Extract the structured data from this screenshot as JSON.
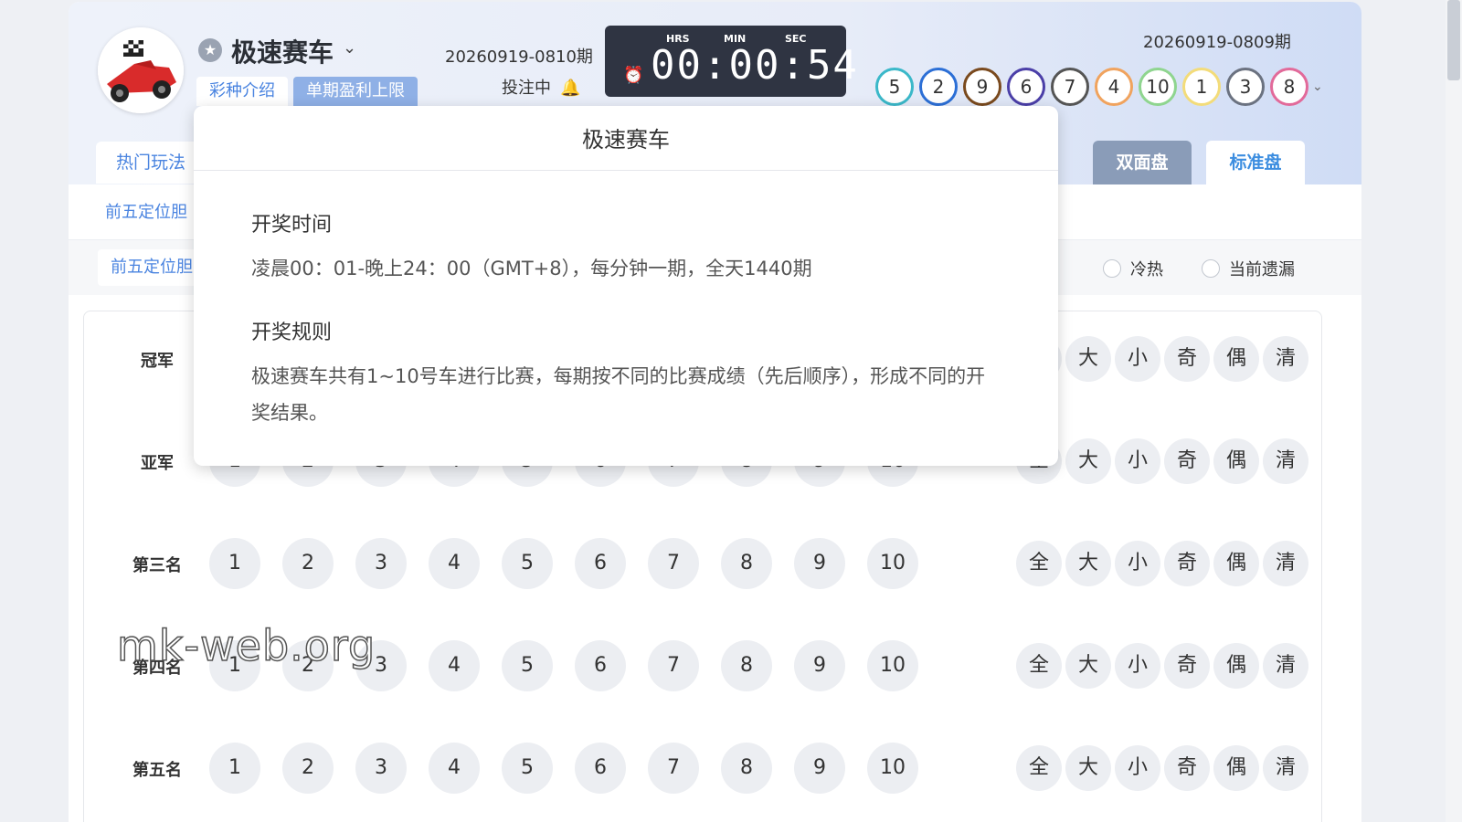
{
  "header": {
    "game_title": "极速赛车",
    "tabs": [
      "彩种介绍",
      "单期盈利上限"
    ],
    "current_period": "20260919-0810期",
    "bet_status": "投注中",
    "timer": {
      "hrs_label": "HRS",
      "min_label": "MIN",
      "sec_label": "SEC",
      "value": "00:00:54"
    },
    "last_period": "20260919-0809期",
    "results": [
      {
        "n": "5",
        "color": "#3bb8c9"
      },
      {
        "n": "2",
        "color": "#2c6fd6"
      },
      {
        "n": "9",
        "color": "#7a4a1e"
      },
      {
        "n": "6",
        "color": "#4b3fa8"
      },
      {
        "n": "7",
        "color": "#555555"
      },
      {
        "n": "4",
        "color": "#f0a35e"
      },
      {
        "n": "10",
        "color": "#8fd58f"
      },
      {
        "n": "1",
        "color": "#f3dc7a"
      },
      {
        "n": "3",
        "color": "#6b7280"
      },
      {
        "n": "8",
        "color": "#e26a9a"
      }
    ]
  },
  "nav": {
    "hot_tab": "热门玩法",
    "mode_dual": "双面盘",
    "mode_standard": "标准盘",
    "sub_item": "前五定位胆",
    "play_chip": "前五定位胆",
    "radio_cold_hot": "冷热",
    "radio_missing": "当前遗漏"
  },
  "board": {
    "rows": [
      "冠军",
      "亚军",
      "第三名",
      "第四名",
      "第五名"
    ],
    "numbers": [
      "1",
      "2",
      "3",
      "4",
      "5",
      "6",
      "7",
      "8",
      "9",
      "10"
    ],
    "quick": [
      "全",
      "大",
      "小",
      "奇",
      "偶",
      "清"
    ]
  },
  "popover": {
    "title": "极速赛车",
    "time_heading": "开奖时间",
    "time_text": "凌晨00：01-晚上24：00（GMT+8），每分钟一期，全天1440期",
    "rule_heading": "开奖规则",
    "rule_text": "极速赛车共有1~10号车进行比赛，每期按不同的比赛成绩（先后顺序），形成不同的开奖结果。"
  },
  "watermark": "mk-web.org"
}
